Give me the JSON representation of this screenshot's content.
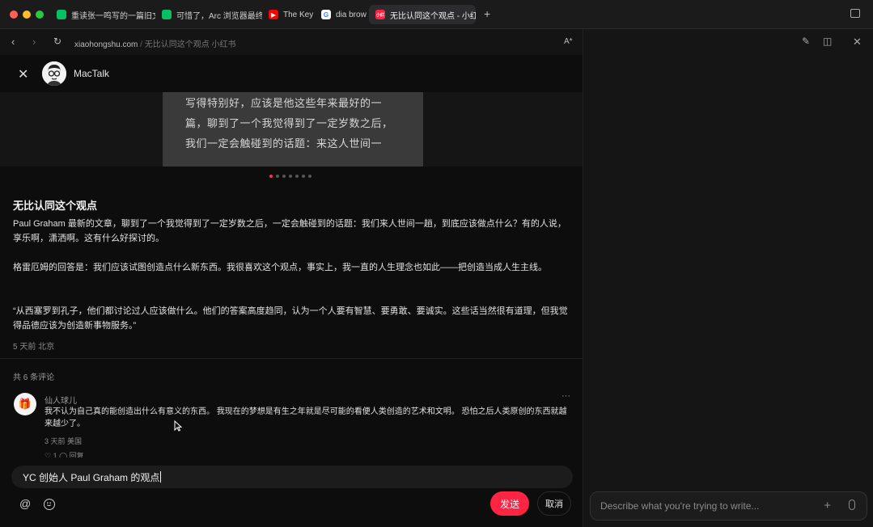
{
  "tabs": [
    {
      "label": "重读张一鸣写的一篇旧文",
      "icon": "wechat-icon",
      "color": "#07c160"
    },
    {
      "label": "可惜了，Arc 浏览器最终",
      "icon": "wechat-icon",
      "color": "#07c160"
    },
    {
      "label": "The Key",
      "icon": "youtube-icon",
      "color": "#ff0000"
    },
    {
      "label": "dia brow",
      "icon": "google-icon",
      "color": "#4285f4"
    },
    {
      "label": "无比认同这个观点 - 小红",
      "icon": "xiaohongshu-icon",
      "color": "#ff2442",
      "favicon_text": "小红"
    }
  ],
  "nav": {
    "url_domain": "xiaohongshu.com",
    "url_sep": "/",
    "url_path": "无比认同这个观点   小红书",
    "reader_label": "A*"
  },
  "note": {
    "author": "MacTalk",
    "image_lines": [
      "写得特别好，应该是他这些年来最好的一",
      "篇，聊到了一个我觉得到了一定岁数之后，",
      "我们一定会触碰到的话题：来这人世间一"
    ],
    "title": "无比认同这个观点",
    "paragraphs": [
      "Paul Graham 最新的文章，聊到了一个我觉得到了一定岁数之后，一定会触碰到的话题：我们来人世间一趟，到底应该做点什么？有的人说，享乐啊，潇洒啊。这有什么好探讨的。",
      "格雷厄姆的回答是：我们应该试图创造点什么新东西。我很喜欢这个观点，事实上，我一直的人生理念也如此——把创造当成人生主线。",
      "“从西塞罗到孔子，他们都讨论过人应该做什么。他们的答案高度趋同，认为一个人要有智慧、要勇敢、要诚实。这些话当然很有道理，但我觉得品德应该为创造新事物服务。”"
    ],
    "meta": "5 天前 北京"
  },
  "comments": {
    "count_label": "共 6 条评论",
    "items": [
      {
        "name": "仙人球儿",
        "text": "我不认为自己真的能创造出什么有意义的东西。 我现在的梦想是有生之年就是尽可能的看便人类创造的艺术和文明。 恐怕之后人类原创的东西就越来越少了。",
        "meta": "3 天前 美国",
        "actions": "♡ 1   ◯ 回复"
      }
    ]
  },
  "composer": {
    "value": "YC 创始人 Paul Graham 的观点",
    "send_label": "发送",
    "cancel_label": "取消"
  },
  "side_panel": {
    "placeholder": "Describe what you're trying to write..."
  },
  "colors": {
    "accent": "#ff2442",
    "background": "#0d0d0d"
  }
}
